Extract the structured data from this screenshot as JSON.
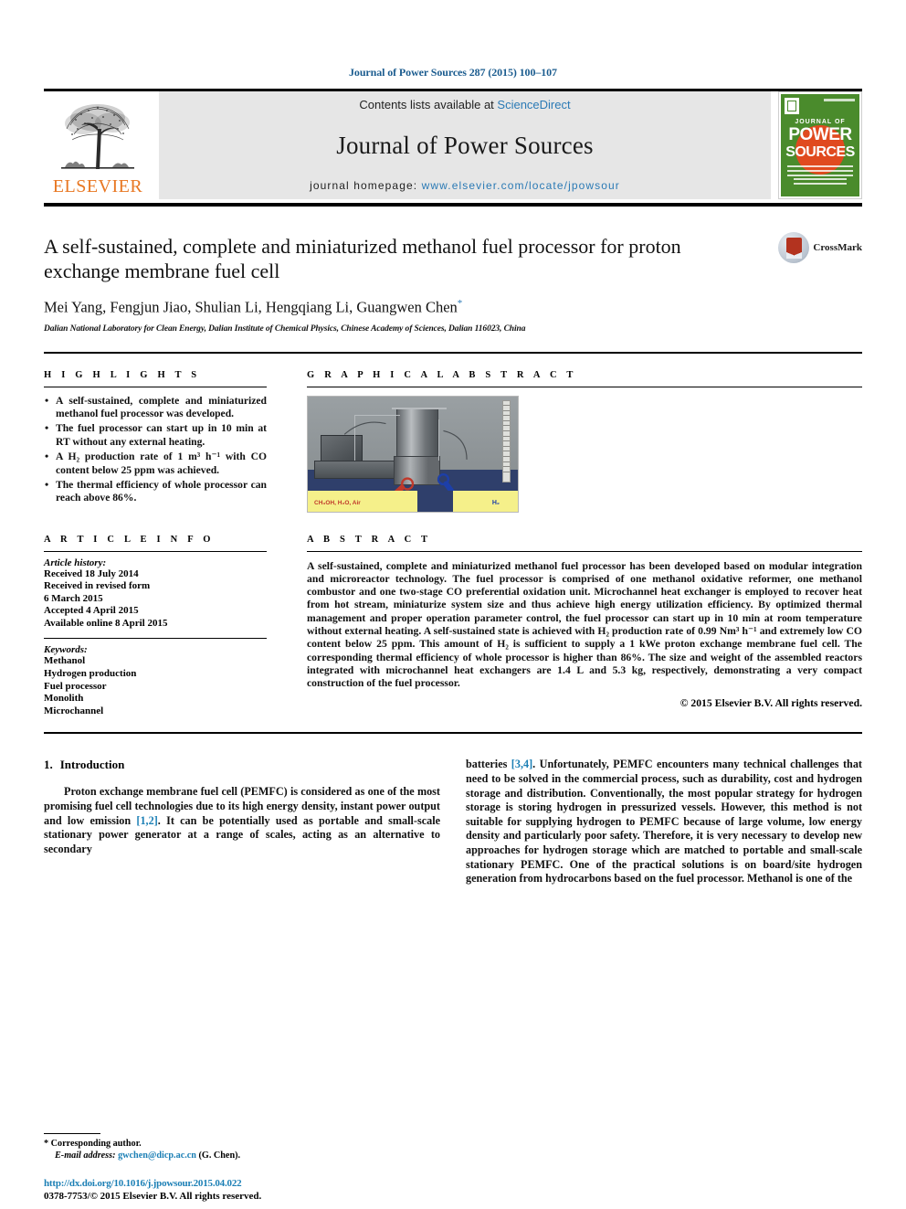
{
  "running_head": "Journal of Power Sources 287 (2015) 100–107",
  "masthead": {
    "publisher": "ELSEVIER",
    "contents_prefix": "Contents lists available at ",
    "contents_link": "ScienceDirect",
    "journal_name": "Journal of Power Sources",
    "homepage_prefix": "journal homepage: ",
    "homepage_url": "www.elsevier.com/locate/jpowsour",
    "cover": {
      "kicker": "JOURNAL OF",
      "word1": "POWER",
      "word2": "SOURCES",
      "accent_color": "#e04a1f",
      "background_color": "#4a8b2c"
    }
  },
  "article": {
    "title": "A self-sustained, complete and miniaturized methanol fuel processor for proton exchange membrane fuel cell",
    "authors": "Mei Yang, Fengjun Jiao, Shulian Li, Hengqiang Li, Guangwen Chen",
    "corresponding_marker": "*",
    "affiliation": "Dalian National Laboratory for Clean Energy, Dalian Institute of Chemical Physics, Chinese Academy of Sciences, Dalian 116023, China",
    "crossmark_label": "CrossMark"
  },
  "highlights": {
    "heading": "H I G H L I G H T S",
    "items": [
      "A self-sustained, complete and miniaturized methanol fuel processor was developed.",
      "The fuel processor can start up in 10 min at RT without any external heating.",
      "A H₂ production rate of 1 m³ h⁻¹ with CO content below 25 ppm was achieved.",
      "The thermal efficiency of whole processor can reach above 86%."
    ]
  },
  "graphical_abstract": {
    "heading": "G R A P H I C A L   A B S T R A C T",
    "image_caption_left": "CH₃OH, H₂O, Air",
    "image_caption_right": "H₂",
    "left_label_color": "#c0392b",
    "right_label_color": "#1d3fa8"
  },
  "article_info": {
    "heading": "A R T I C L E   I N F O",
    "history_label": "Article history:",
    "history": [
      "Received 18 July 2014",
      "Received in revised form",
      "6 March 2015",
      "Accepted 4 April 2015",
      "Available online 8 April 2015"
    ],
    "keywords_label": "Keywords:",
    "keywords": [
      "Methanol",
      "Hydrogen production",
      "Fuel processor",
      "Monolith",
      "Microchannel"
    ]
  },
  "abstract": {
    "heading": "A B S T R A C T",
    "text": "A self-sustained, complete and miniaturized methanol fuel processor has been developed based on modular integration and microreactor technology. The fuel processor is comprised of one methanol oxidative reformer, one methanol combustor and one two-stage CO preferential oxidation unit. Microchannel heat exchanger is employed to recover heat from hot stream, miniaturize system size and thus achieve high energy utilization efficiency. By optimized thermal management and proper operation parameter control, the fuel processor can start up in 10 min at room temperature without external heating. A self-sustained state is achieved with H₂ production rate of 0.99 Nm³ h⁻¹ and extremely low CO content below 25 ppm. This amount of H₂ is sufficient to supply a 1 kWe proton exchange membrane fuel cell. The corresponding thermal efficiency of whole processor is higher than 86%. The size and weight of the assembled reactors integrated with microchannel heat exchangers are 1.4 L and 5.3 kg, respectively, demonstrating a very compact construction of the fuel processor.",
    "copyright": "© 2015 Elsevier B.V. All rights reserved."
  },
  "introduction": {
    "number": "1.",
    "heading": "Introduction",
    "left_paragraph": "Proton exchange membrane fuel cell (PEMFC) is considered as one of the most promising fuel cell technologies due to its high energy density, instant power output and low emission [1,2]. It can be potentially used as portable and small-scale stationary power generator at a range of scales, acting as an alternative to secondary",
    "left_ref": "[1,2]",
    "right_paragraph": "batteries [3,4]. Unfortunately, PEMFC encounters many technical challenges that need to be solved in the commercial process, such as durability, cost and hydrogen storage and distribution. Conventionally, the most popular strategy for hydrogen storage is storing hydrogen in pressurized vessels. However, this method is not suitable for supplying hydrogen to PEMFC because of large volume, low energy density and particularly poor safety. Therefore, it is very necessary to develop new approaches for hydrogen storage which are matched to portable and small-scale stationary PEMFC. One of the practical solutions is on board/site hydrogen generation from hydrocarbons based on the fuel processor. Methanol is one of the",
    "right_ref": "[3,4]"
  },
  "footer": {
    "corresponding_marker": "*",
    "corresponding_label": "Corresponding author.",
    "email_label": "E-mail address:",
    "email": "gwchen@dicp.ac.cn",
    "email_suffix": "(G. Chen).",
    "doi": "http://dx.doi.org/10.1016/j.jpowsour.2015.04.022",
    "issn_line": "0378-7753/© 2015 Elsevier B.V. All rights reserved.",
    "link_color": "#1b7fb5"
  }
}
